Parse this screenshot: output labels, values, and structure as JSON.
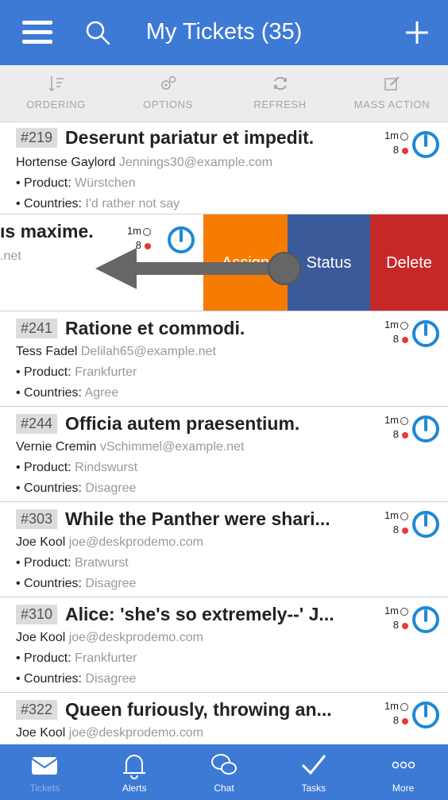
{
  "header": {
    "title": "My Tickets (35)",
    "menu_icon": "hamburger-menu-icon",
    "search_icon": "search-icon",
    "add_icon": "plus-icon",
    "color": "#3d7ad6"
  },
  "toolbar": {
    "items": [
      {
        "label": "ORDERING",
        "icon": "sort-icon"
      },
      {
        "label": "OPTIONS",
        "icon": "gears-icon"
      },
      {
        "label": "REFRESH",
        "icon": "refresh-icon"
      },
      {
        "label": "MASS ACTION",
        "icon": "edit-icon"
      }
    ]
  },
  "swiped_ticket": {
    "subject_fragment": "ıs maxime.",
    "email_fragment": ".net",
    "time": "1m",
    "count": "8",
    "actions": [
      {
        "label": "Assign",
        "color": "#f57c00"
      },
      {
        "label": "Status",
        "color": "#3a5a99"
      },
      {
        "label": "Delete",
        "color": "#c62828"
      }
    ]
  },
  "tickets": [
    {
      "id": "#219",
      "subject": "Deserunt pariatur et impedit.",
      "person": "Hortense Gaylord",
      "email": "Jennings30@example.com",
      "product_label": "Product:",
      "product": "Würstchen",
      "countries_label": "Countries:",
      "countries": "I'd rather not say",
      "time": "1m",
      "count": "8"
    },
    {
      "id": "#241",
      "subject": "Ratione et commodi.",
      "person": "Tess Fadel",
      "email": "Delilah65@example.net",
      "product_label": "Product:",
      "product": "Frankfurter",
      "countries_label": "Countries:",
      "countries": "Agree",
      "time": "1m",
      "count": "8"
    },
    {
      "id": "#244",
      "subject": "Officia autem praesentium.",
      "person": "Vernie Cremin",
      "email": "vSchimmel@example.net",
      "product_label": "Product:",
      "product": "Rindswurst",
      "countries_label": "Countries:",
      "countries": "Disagree",
      "time": "1m",
      "count": "8"
    },
    {
      "id": "#303",
      "subject": "While the Panther were shari...",
      "person": "Joe Kool",
      "email": "joe@deskprodemo.com",
      "product_label": "Product:",
      "product": "Bratwurst",
      "countries_label": "Countries:",
      "countries": "Disagree",
      "time": "1m",
      "count": "8"
    },
    {
      "id": "#310",
      "subject": "Alice: 'she's so extremely--' J...",
      "person": "Joe Kool",
      "email": "joe@deskprodemo.com",
      "product_label": "Product:",
      "product": "Frankfurter",
      "countries_label": "Countries:",
      "countries": "Disagree",
      "time": "1m",
      "count": "8"
    },
    {
      "id": "#322",
      "subject": "Queen furiously, throwing an...",
      "person": "Joe Kool",
      "email": "joe@deskprodemo.com",
      "product_label": "",
      "product": "",
      "countries_label": "",
      "countries": "",
      "time": "1m",
      "count": "8"
    }
  ],
  "tabbar": {
    "items": [
      {
        "label": "Tickets",
        "icon": "envelope-icon",
        "active": true
      },
      {
        "label": "Alerts",
        "icon": "bell-icon",
        "active": false
      },
      {
        "label": "Chat",
        "icon": "chat-bubbles-icon",
        "active": false
      },
      {
        "label": "Tasks",
        "icon": "checkmark-icon",
        "active": false
      },
      {
        "label": "More",
        "icon": "more-dots-icon",
        "active": false
      }
    ]
  }
}
